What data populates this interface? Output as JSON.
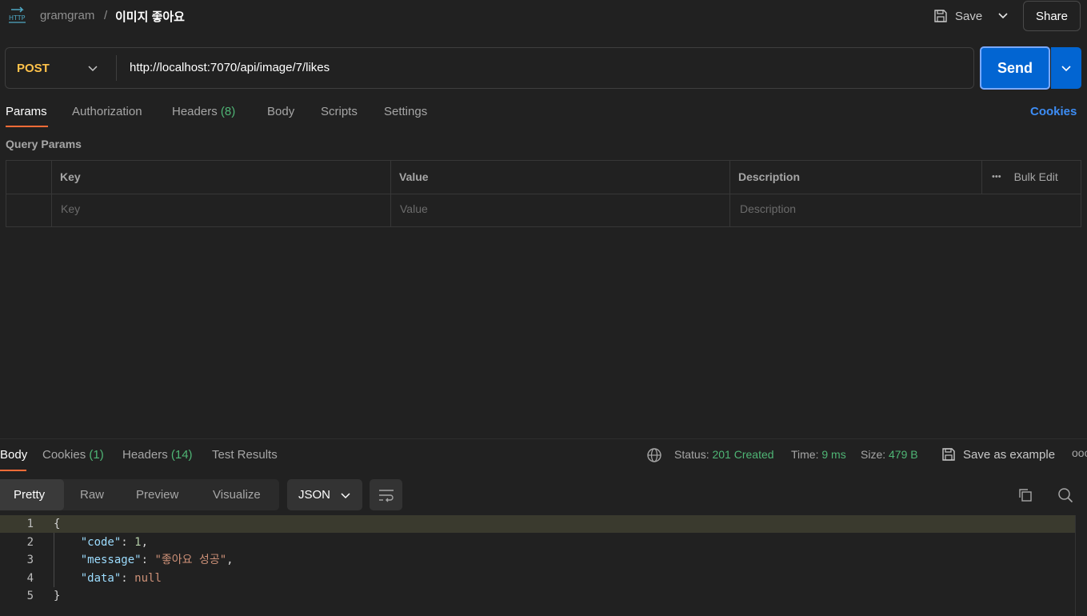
{
  "header": {
    "collection": "gramgram",
    "separator": "/",
    "request_name": "이미지 좋아요",
    "save_label": "Save",
    "share_label": "Share"
  },
  "request": {
    "method": "POST",
    "url": "http://localhost:7070/api/image/7/likes",
    "send_label": "Send"
  },
  "request_tabs": {
    "params": "Params",
    "authorization": "Authorization",
    "headers": "Headers",
    "headers_count": "(8)",
    "body": "Body",
    "scripts": "Scripts",
    "settings": "Settings",
    "cookies": "Cookies"
  },
  "query_params": {
    "label": "Query Params",
    "columns": {
      "key": "Key",
      "value": "Value",
      "description": "Description"
    },
    "bulk_edit": "Bulk Edit",
    "more": "•••",
    "placeholders": {
      "key": "Key",
      "value": "Value",
      "description": "Description"
    }
  },
  "response_tabs": {
    "body": "Body",
    "cookies": "Cookies",
    "cookies_count": "(1)",
    "headers": "Headers",
    "headers_count": "(14)",
    "test_results": "Test Results"
  },
  "response_meta": {
    "status_label": "Status:",
    "status_value": "201 Created",
    "time_label": "Time:",
    "time_value": "9 ms",
    "size_label": "Size:",
    "size_value": "479 B",
    "save_example": "Save as example",
    "more": "ooo"
  },
  "view_modes": {
    "pretty": "Pretty",
    "raw": "Raw",
    "preview": "Preview",
    "visualize": "Visualize",
    "format": "JSON"
  },
  "code": {
    "line_numbers": [
      "1",
      "2",
      "3",
      "4",
      "5"
    ],
    "open_brace": "{",
    "close_brace": "}",
    "key_code": "\"code\"",
    "val_code": "1",
    "key_message": "\"message\"",
    "val_message": "\"좋아요 성공\"",
    "key_data": "\"data\"",
    "val_data": "null"
  },
  "colors": {
    "accent": "#ff6c37",
    "send": "#0265d2",
    "method": "#ffc24a",
    "success": "#4fb575",
    "link": "#3d8df5"
  }
}
